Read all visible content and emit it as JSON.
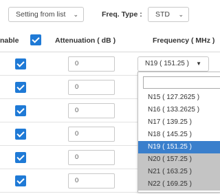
{
  "toolbar": {
    "mode_select": "Setting from list",
    "freq_type_label": "Freq. Type :",
    "freq_type_select": "STD"
  },
  "table": {
    "headers": {
      "enable": "nable",
      "attenuation": "Attenuation ( dB )",
      "frequency": "Frequency ( MHz )"
    },
    "rows": [
      {
        "enabled": true,
        "attenuation": "0",
        "frequency": "N19 ( 151.25 )"
      },
      {
        "enabled": true,
        "attenuation": "0"
      },
      {
        "enabled": true,
        "attenuation": "0"
      },
      {
        "enabled": true,
        "attenuation": "0"
      },
      {
        "enabled": true,
        "attenuation": "0"
      },
      {
        "enabled": true,
        "attenuation": "0"
      }
    ]
  },
  "dropdown": {
    "search_value": "",
    "options": [
      {
        "label": "N15 ( 127.2625 )",
        "state": "normal"
      },
      {
        "label": "N16 ( 133.2625 )",
        "state": "normal"
      },
      {
        "label": "N17 ( 139.25 )",
        "state": "normal"
      },
      {
        "label": "N18 ( 145.25 )",
        "state": "normal"
      },
      {
        "label": "N19 ( 151.25 )",
        "state": "selected"
      },
      {
        "label": "N20 ( 157.25 )",
        "state": "grayed"
      },
      {
        "label": "N21 ( 163.25 )",
        "state": "grayed"
      },
      {
        "label": "N22 ( 169.25 )",
        "state": "grayed"
      }
    ]
  },
  "colors": {
    "checkbox": "#1f7ad6",
    "selected_option": "#3a7fcc",
    "grayed_option": "#c4c4c4"
  }
}
